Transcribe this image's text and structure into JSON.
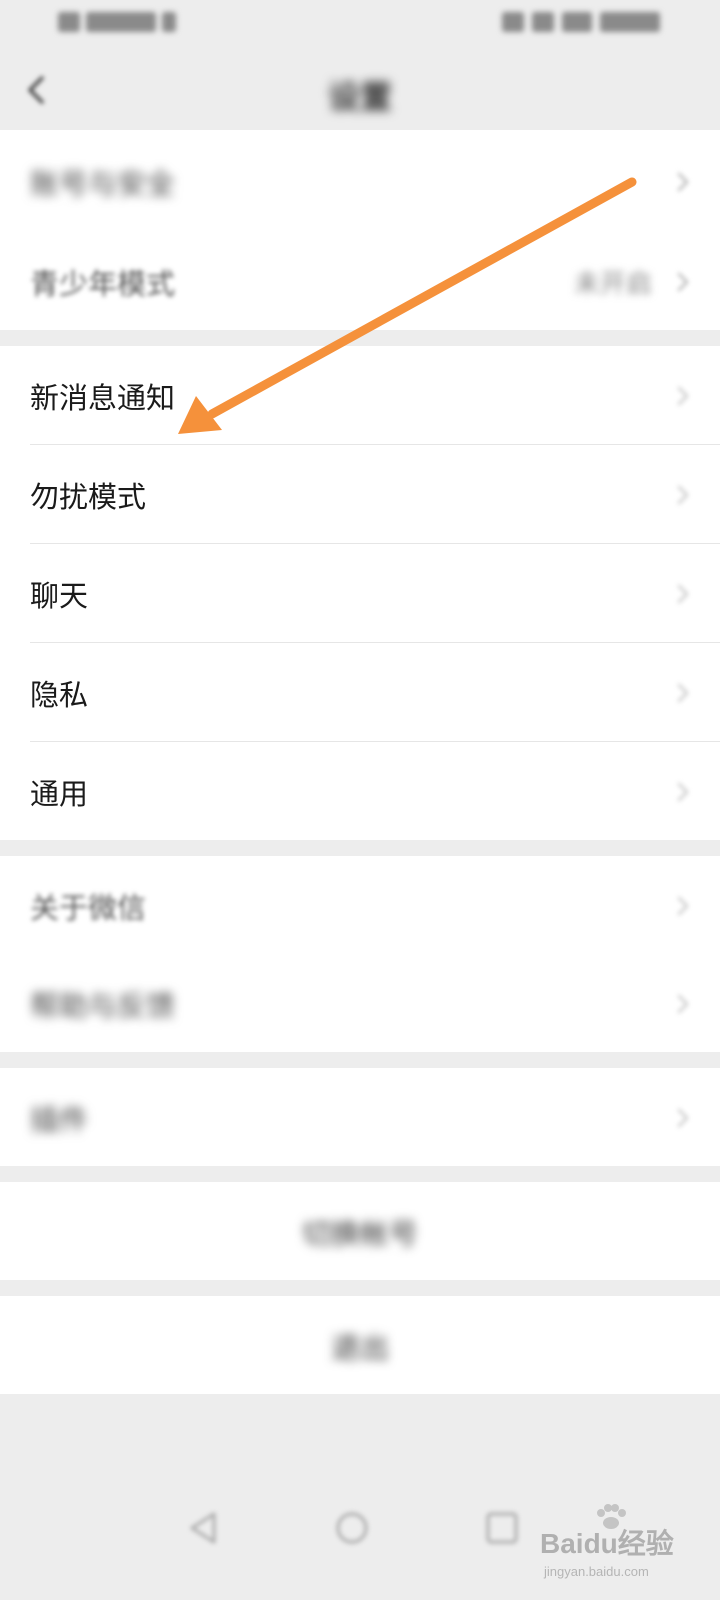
{
  "status_bar": {
    "left_text": "",
    "right_text": ""
  },
  "nav": {
    "title": "设置"
  },
  "groups": [
    {
      "items": [
        {
          "label": "账号与安全",
          "value": ""
        },
        {
          "label": "青少年模式",
          "value": "未开启"
        }
      ]
    },
    {
      "items": [
        {
          "label": "新消息通知",
          "value": ""
        },
        {
          "label": "勿扰模式",
          "value": ""
        },
        {
          "label": "聊天",
          "value": ""
        },
        {
          "label": "隐私",
          "value": ""
        },
        {
          "label": "通用",
          "value": ""
        }
      ]
    },
    {
      "items": [
        {
          "label": "关于微信",
          "value": ""
        },
        {
          "label": "帮助与反馈",
          "value": ""
        }
      ]
    },
    {
      "items": [
        {
          "label": "插件",
          "value": ""
        }
      ]
    }
  ],
  "actions": {
    "switch_account": "切换帐号",
    "logout": "退出"
  },
  "watermark": {
    "brand": "Baidu经验",
    "url": "jingyan.baidu.com"
  },
  "colors": {
    "background": "#ededed",
    "card": "#ffffff",
    "text": "#1a1a1a",
    "secondary_text": "#888888",
    "annotation_arrow": "#f5913b"
  },
  "icons": {
    "back": "chevron-left-icon",
    "row_arrow": "chevron-right-icon",
    "system_back": "triangle-back-icon",
    "system_home": "circle-home-icon",
    "system_recents": "square-recents-icon"
  }
}
